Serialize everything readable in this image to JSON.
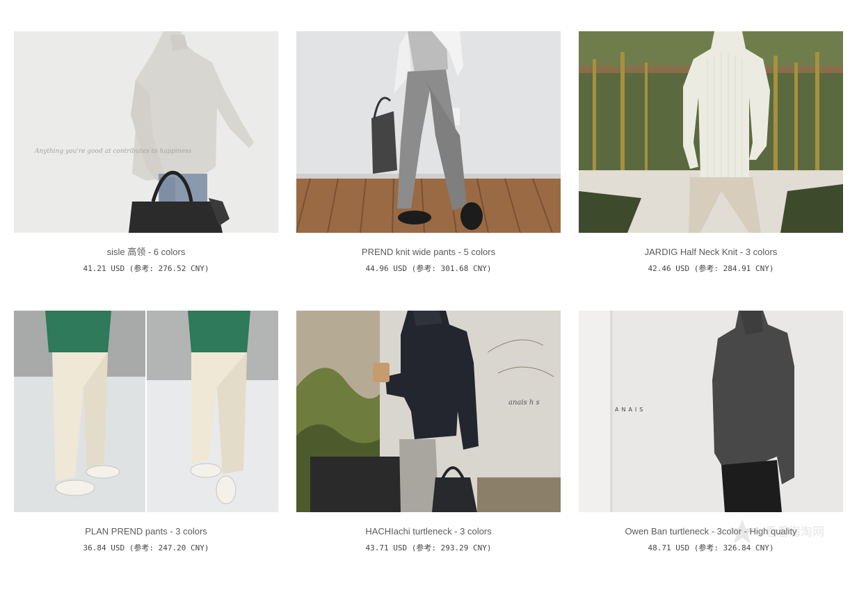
{
  "products": [
    {
      "name": "sisle 高领 - 6 colors",
      "price": "41.21 USD (参考: 276.52 CNY)",
      "image": "cream-turtleneck-sweater-photo",
      "image_text": "Anything you're good at contributes to happiness"
    },
    {
      "name": "PREND knit wide pants - 5 colors",
      "price": "44.96 USD (参考: 301.68 CNY)",
      "image": "gray-wide-pants-photo"
    },
    {
      "name": "JARDIG Half Neck Knit - 3 colors",
      "price": "42.46 USD (参考: 284.91 CNY)",
      "image": "ivory-ribbed-knit-photo"
    },
    {
      "name": "PLAN PREND pants - 3 colors",
      "price": "36.84 USD (参考: 247.20 CNY)",
      "image": "cream-wide-pants-photo"
    },
    {
      "name": "HACHIachi turtleneck - 3 colors",
      "price": "43.71 USD (参考: 293.29 CNY)",
      "image": "navy-turtleneck-photo",
      "image_text": "anais h s"
    },
    {
      "name": "Owen Ban turtleneck - 3color - High quality",
      "price": "48.71 USD (参考: 326.84 CNY)",
      "image": "charcoal-turtleneck-photo",
      "image_text": "ANAIS"
    }
  ],
  "watermark": {
    "text": "看看海淘网",
    "icon": "star-logo-icon"
  },
  "colors": {
    "name_text": "#5a5a5a",
    "price_text": "#444444",
    "background": "#ffffff"
  }
}
